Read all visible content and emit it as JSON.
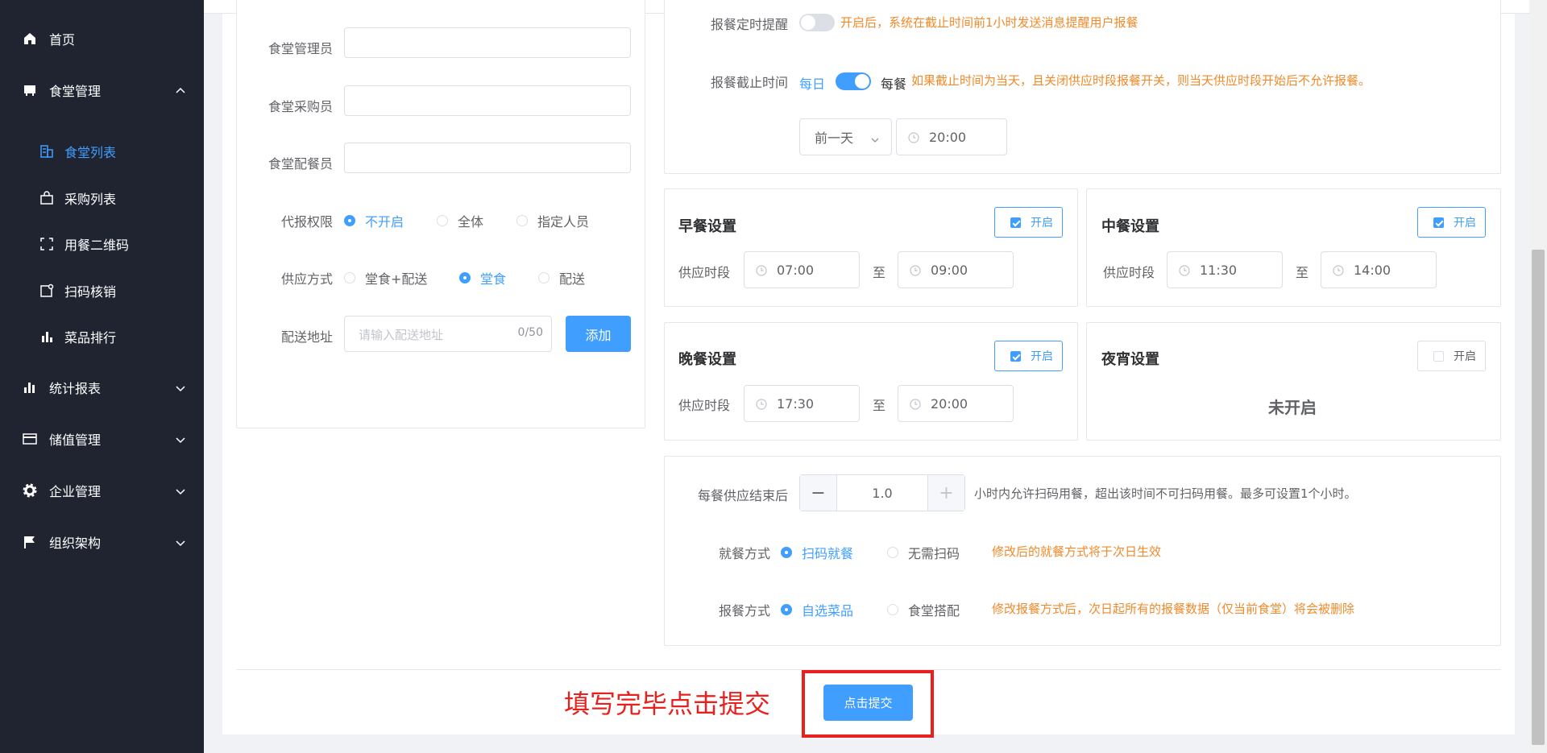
{
  "sidebar": {
    "items": [
      {
        "label": "首页",
        "icon": "home-icon"
      },
      {
        "label": "食堂管理",
        "icon": "canteen-icon",
        "expanded": true
      },
      {
        "label": "统计报表",
        "icon": "chart-icon"
      },
      {
        "label": "储值管理",
        "icon": "card-icon"
      },
      {
        "label": "企业管理",
        "icon": "gear-icon"
      },
      {
        "label": "组织架构",
        "icon": "flag-icon"
      }
    ],
    "subitems": [
      {
        "label": "食堂列表",
        "icon": "building-icon",
        "active": true
      },
      {
        "label": "采购列表",
        "icon": "bag-icon"
      },
      {
        "label": "用餐二维码",
        "icon": "qrcode-icon"
      },
      {
        "label": "扫码核销",
        "icon": "scan-icon"
      },
      {
        "label": "菜品排行",
        "icon": "bar-chart-icon"
      }
    ]
  },
  "left_form": {
    "manager_label": "食堂管理员",
    "buyer_label": "食堂采购员",
    "dispatcher_label": "食堂配餐员",
    "proxy_label": "代报权限",
    "proxy_options": [
      "不开启",
      "全体",
      "指定人员"
    ],
    "proxy_selected": "不开启",
    "supply_label": "供应方式",
    "supply_options": [
      "堂食+配送",
      "堂食",
      "配送"
    ],
    "supply_selected": "堂食",
    "address_label": "配送地址",
    "address_placeholder": "请输入配送地址",
    "address_count": "0/50",
    "add_button": "添加"
  },
  "right_top": {
    "reminder_label": "报餐定时提醒",
    "reminder_on": false,
    "reminder_hint": "开启后，系统在截止时间前1小时发送消息提醒用户报餐",
    "deadline_label": "报餐截止时间",
    "deadline_left": "每日",
    "deadline_right": "每餐",
    "deadline_on": true,
    "deadline_hint": "如果截止时间为当天，且关闭供应时段报餐开关，则当天供应时段开始后不允许报餐。",
    "deadline_day": "前一天",
    "deadline_time": "20:00"
  },
  "meals": {
    "supply_label": "供应时段",
    "to": "至",
    "enable_label": "开启",
    "breakfast": {
      "title": "早餐设置",
      "enabled": true,
      "start": "07:00",
      "end": "09:00"
    },
    "lunch": {
      "title": "中餐设置",
      "enabled": true,
      "start": "11:30",
      "end": "14:00"
    },
    "dinner": {
      "title": "晚餐设置",
      "enabled": true,
      "start": "17:30",
      "end": "20:00"
    },
    "night": {
      "title": "夜宵设置",
      "enabled": false,
      "status": "未开启"
    }
  },
  "bottom_settings": {
    "after_label": "每餐供应结束后",
    "stepper_value": "1.0",
    "stepper_minus": "−",
    "stepper_plus": "+",
    "after_hint": "小时内允许扫码用餐，超出该时间不可扫码用餐。最多可设置1个小时。",
    "dine_label": "就餐方式",
    "dine_options": [
      "扫码就餐",
      "无需扫码"
    ],
    "dine_selected": "扫码就餐",
    "dine_hint": "修改后的就餐方式将于次日生效",
    "order_label": "报餐方式",
    "order_options": [
      "自选菜品",
      "食堂搭配"
    ],
    "order_selected": "自选菜品",
    "order_hint": "修改报餐方式后，次日起所有的报餐数据（仅当前食堂）将会被删除"
  },
  "submit": {
    "button": "点击提交",
    "annotation": "填写完毕点击提交"
  },
  "colors": {
    "primary": "#409eff",
    "sidebar_bg": "#1f2430",
    "warning": "#f08a2a",
    "annotation": "#e8211f"
  }
}
